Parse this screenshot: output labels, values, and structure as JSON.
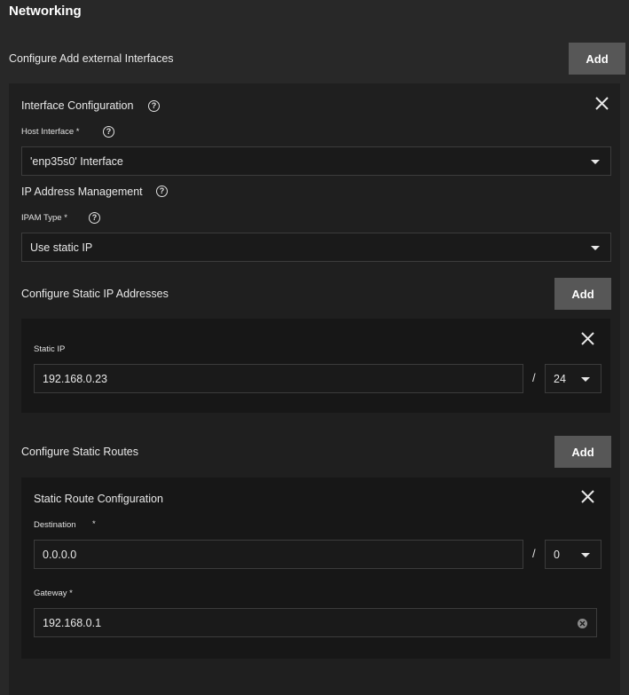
{
  "page": {
    "title": "Networking"
  },
  "interfaces_section": {
    "label": "Configure Add external Interfaces",
    "add_label": "Add"
  },
  "interface": {
    "heading": "Interface Configuration",
    "host_interface_label": "Host Interface *",
    "host_interface_value": "'enp35s0' Interface",
    "ipam_heading": "IP Address Management",
    "ipam_type_label": "IPAM Type *",
    "ipam_type_value": "Use static IP"
  },
  "static_ips": {
    "label": "Configure Static IP Addresses",
    "add_label": "Add",
    "item": {
      "field_label": "Static IP",
      "ip_value": "192.168.0.23",
      "separator": "/",
      "mask_value": "24"
    }
  },
  "static_routes": {
    "label": "Configure Static Routes",
    "add_label": "Add",
    "item": {
      "heading": "Static Route Configuration",
      "destination_label": "Destination",
      "destination_required": "*",
      "destination_value": "0.0.0.0",
      "separator": "/",
      "destination_mask": "0",
      "gateway_label": "Gateway *",
      "gateway_value": "192.168.0.1"
    }
  },
  "icons": {
    "help": "help-circle-icon",
    "close": "close-icon",
    "dropdown": "chevron-down-icon",
    "clear": "clear-icon"
  },
  "colors": {
    "background": "#282828",
    "panel": "#1f1f1f",
    "inner_panel": "#171717",
    "button": "#575757",
    "text": "#e8e8e8"
  }
}
